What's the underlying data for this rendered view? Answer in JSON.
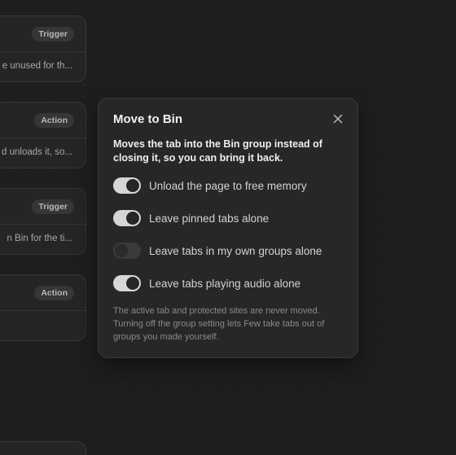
{
  "flow_cards": [
    {
      "badge": "Trigger",
      "description": "e unused for th..."
    },
    {
      "badge": "Action",
      "description": "d unloads it, so..."
    },
    {
      "badge": "Trigger",
      "description": "n Bin for the ti..."
    },
    {
      "badge": "Action",
      "description": ""
    }
  ],
  "popover": {
    "title": "Move to Bin",
    "description": "Moves the tab into the Bin group instead of closing it, so you can bring it back.",
    "options": [
      {
        "label": "Unload the page to free memory",
        "enabled": true
      },
      {
        "label": "Leave pinned tabs alone",
        "enabled": true
      },
      {
        "label": "Leave tabs in my own groups alone",
        "enabled": false
      },
      {
        "label": "Leave tabs playing audio alone",
        "enabled": true
      }
    ],
    "note": "The active tab and protected sites are never moved. Turning off the group setting lets Few take tabs out of groups you made yourself."
  },
  "icons": {
    "close": "close-icon"
  },
  "colors": {
    "background": "#1e1e1e",
    "panel": "#272727",
    "toggle_on": "#d6d6d6",
    "toggle_off": "#3a3a3a"
  }
}
